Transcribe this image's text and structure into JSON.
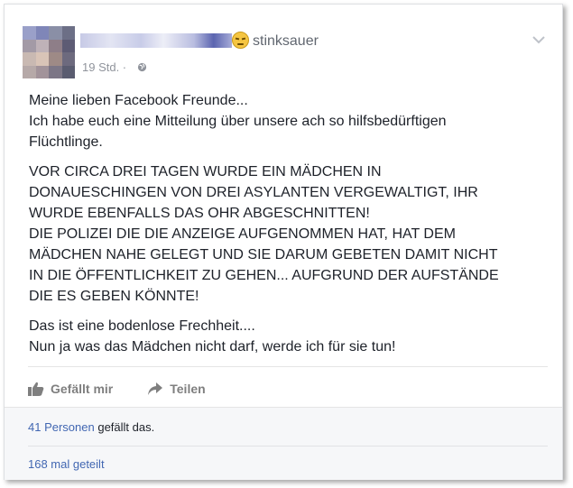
{
  "post": {
    "feeling": "stinksauer",
    "feeling_icon": "angry-face-emoji",
    "timestamp": "19 Std. ·",
    "privacy_icon": "globe-icon",
    "paragraphs": [
      [
        "Meine lieben Facebook Freunde...",
        "Ich habe euch eine Mitteilung über unsere ach so hilfsbedürftigen",
        "Flüchtlinge."
      ],
      [
        "VOR CIRCA DREI TAGEN WURDE EIN MÄDCHEN IN",
        "DONAUESCHINGEN VON DREI ASYLANTEN VERGEWALTIGT, IHR",
        "WURDE EBENFALLS DAS OHR ABGESCHNITTEN!",
        "DIE POLIZEI DIE DIE ANZEIGE AUFGENOMMEN HAT, HAT DEM",
        "MÄDCHEN NAHE GELEGT UND SIE DARUM GEBETEN DAMIT NICHT",
        "IN DIE ÖFFENTLICHKEIT ZU GEHEN... AUFGRUND DER AUFSTÄNDE",
        "DIE ES GEBEN KÖNNTE!"
      ],
      [
        "Das ist eine bodenlose Frechheit....",
        "Nun ja was das Mädchen nicht darf, werde ich für sie tun!"
      ]
    ]
  },
  "actions": {
    "like_label": "Gefällt mir",
    "like_icon": "thumbs-up-icon",
    "share_label": "Teilen",
    "share_icon": "share-arrow-icon"
  },
  "stats": {
    "likes_link": "41 Personen",
    "likes_suffix": " gefällt das.",
    "shares": "168 mal geteilt"
  },
  "colors": {
    "link": "#4267b2",
    "text": "#1d2129",
    "muted": "#90949c",
    "action": "#7f7f7f",
    "footer_bg": "#f6f7f9"
  }
}
